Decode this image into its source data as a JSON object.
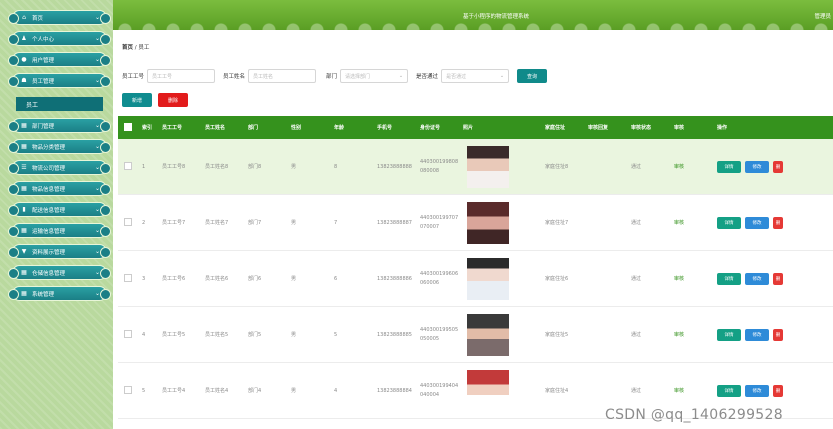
{
  "app": {
    "title": "基于小程序的物流管理系统",
    "user": "管理员"
  },
  "sidebar": {
    "items": [
      {
        "label": "首页",
        "icon": "home-icon",
        "glyph": "⌂"
      },
      {
        "label": "个人中心",
        "icon": "user-icon",
        "glyph": "♟"
      },
      {
        "label": "用户管理",
        "icon": "person-icon",
        "glyph": "●"
      },
      {
        "label": "员工管理",
        "icon": "team-icon",
        "glyph": "☗"
      },
      {
        "label": "部门管理",
        "icon": "grid-icon",
        "glyph": "▦"
      },
      {
        "label": "物品分类管理",
        "icon": "grid-icon",
        "glyph": "▦"
      },
      {
        "label": "物流公司管理",
        "icon": "list-icon",
        "glyph": "☰"
      },
      {
        "label": "物品信息管理",
        "icon": "grid-icon",
        "glyph": "▦"
      },
      {
        "label": "配送信息管理",
        "icon": "chart-icon",
        "glyph": "▮"
      },
      {
        "label": "运输信息管理",
        "icon": "grid-icon",
        "glyph": "▦"
      },
      {
        "label": "资料展示管理",
        "icon": "filter-icon",
        "glyph": "▼"
      },
      {
        "label": "仓储信息管理",
        "icon": "grid-icon",
        "glyph": "▦"
      },
      {
        "label": "系统管理",
        "icon": "grid-icon",
        "glyph": "▦"
      }
    ],
    "active_sub": "员工"
  },
  "breadcrumb": {
    "home": "首页",
    "sep": "/",
    "current": "员工"
  },
  "filters": {
    "emp_no_label": "员工工号",
    "emp_no_placeholder": "员工工号",
    "emp_name_label": "员工姓名",
    "emp_name_placeholder": "员工姓名",
    "dept_label": "部门",
    "dept_placeholder": "请选择部门",
    "approved_label": "是否通过",
    "approved_placeholder": "是否通过",
    "search_label": "查询"
  },
  "actions": {
    "add_label": "新增",
    "delete_label": "删除"
  },
  "table": {
    "headers": [
      "索引",
      "员工工号",
      "员工姓名",
      "部门",
      "性别",
      "年龄",
      "手机号",
      "身份证号",
      "照片",
      "家庭住址",
      "审核回复",
      "审核状态",
      "审核",
      "操作"
    ],
    "op_view": "详情",
    "op_edit": "修改",
    "op_delete": "删",
    "rows": [
      {
        "index": "1",
        "emp_no": "员工工号8",
        "name": "员工姓名8",
        "dept": "部门8",
        "gender": "男",
        "age": "8",
        "phone": "13823888888",
        "id_card": "440300199808080008",
        "address": "家庭住址8",
        "reply": "",
        "status": "通过",
        "audit": "审核"
      },
      {
        "index": "2",
        "emp_no": "员工工号7",
        "name": "员工姓名7",
        "dept": "部门7",
        "gender": "男",
        "age": "7",
        "phone": "13823888887",
        "id_card": "440300199707070007",
        "address": "家庭住址7",
        "reply": "",
        "status": "通过",
        "audit": "审核"
      },
      {
        "index": "3",
        "emp_no": "员工工号6",
        "name": "员工姓名6",
        "dept": "部门6",
        "gender": "男",
        "age": "6",
        "phone": "13823888886",
        "id_card": "440300199606060006",
        "address": "家庭住址6",
        "reply": "",
        "status": "通过",
        "audit": "审核"
      },
      {
        "index": "4",
        "emp_no": "员工工号5",
        "name": "员工姓名5",
        "dept": "部门5",
        "gender": "男",
        "age": "5",
        "phone": "13823888885",
        "id_card": "440300199505050005",
        "address": "家庭住址5",
        "reply": "",
        "status": "通过",
        "audit": "审核"
      },
      {
        "index": "5",
        "emp_no": "员工工号4",
        "name": "员工姓名4",
        "dept": "部门4",
        "gender": "男",
        "age": "4",
        "phone": "13823888884",
        "id_card": "440300199404040004",
        "address": "家庭住址4",
        "reply": "",
        "status": "通过",
        "audit": "审核"
      }
    ]
  },
  "colors": {
    "accent": "#35921d",
    "teal": "#0f8c8f",
    "danger": "#e21b1b"
  },
  "watermark": "CSDN @qq_1406299528"
}
